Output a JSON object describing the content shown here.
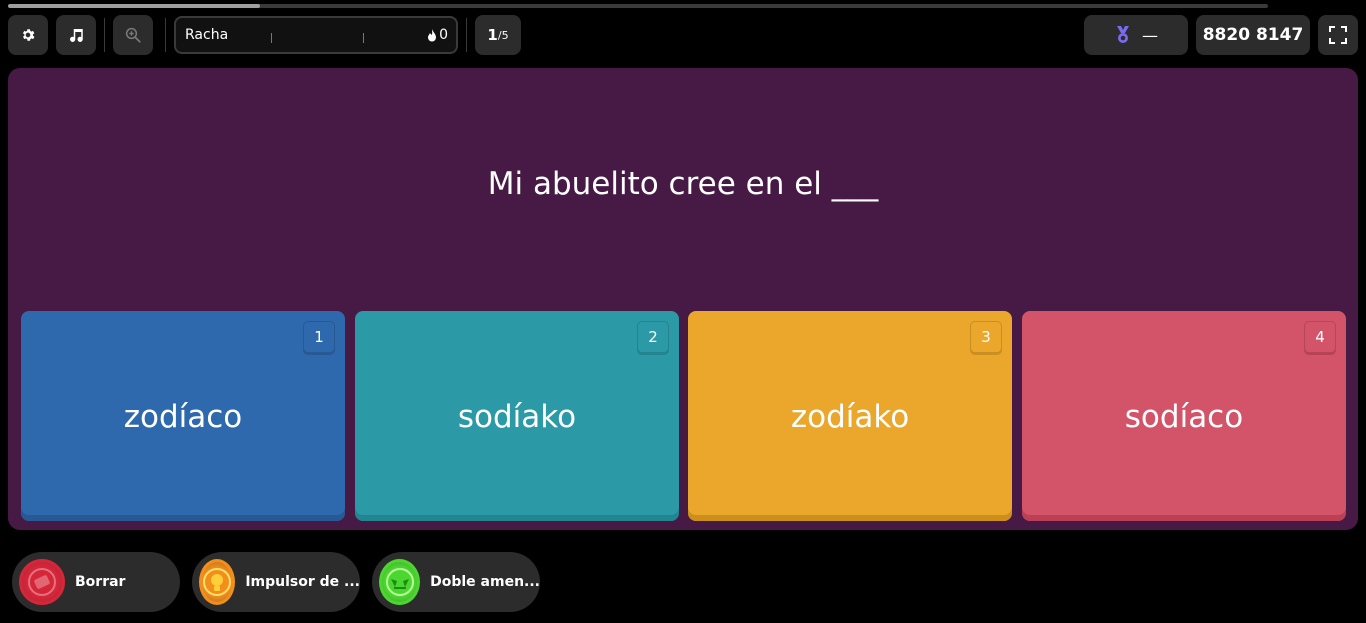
{
  "progress": {
    "fraction": 0.2
  },
  "toolbar": {
    "settings_icon": "gear-icon",
    "music_icon": "music-note-icon",
    "zoom_icon": "zoom-in-icon",
    "fullscreen_icon": "fullscreen-icon"
  },
  "streak": {
    "label": "Racha",
    "value": "0"
  },
  "question_counter": {
    "current": "1",
    "total": "/5"
  },
  "rank": {
    "value": "—"
  },
  "score": {
    "value": "8820 8147"
  },
  "question": {
    "text": "Mi abuelito cree en el ___"
  },
  "options": [
    {
      "number": "1",
      "text": "zodíaco",
      "color": "#2f69ad",
      "shadow": "#275a94"
    },
    {
      "number": "2",
      "text": "sodíako",
      "color": "#2b9aa6",
      "shadow": "#238590"
    },
    {
      "number": "3",
      "text": "zodíako",
      "color": "#eaa72c",
      "shadow": "#cc8f1c"
    },
    {
      "number": "4",
      "text": "sodíaco",
      "color": "#d35468",
      "shadow": "#bb3f55"
    }
  ],
  "powerups": [
    {
      "label": "Borrar",
      "color": "#d5263a"
    },
    {
      "label": "Impulsor de ...",
      "color": "#f28e1c"
    },
    {
      "label": "Doble amen...",
      "color": "#4cd630"
    }
  ]
}
